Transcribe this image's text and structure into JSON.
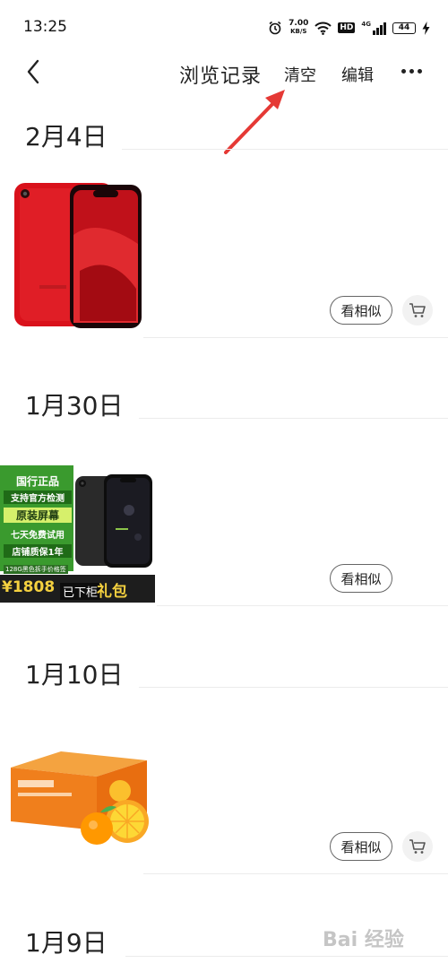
{
  "status_bar": {
    "time": "13:25",
    "net_speed_value": "7.00",
    "net_speed_unit": "KB/S",
    "hd_badge": "HD",
    "signal_label": "4G",
    "battery_level": "44"
  },
  "header": {
    "title": "浏览记录",
    "clear_label": "清空",
    "edit_label": "编辑"
  },
  "groups": [
    {
      "date": "2月4日",
      "item": {
        "similar_label": "看相似",
        "has_cart": true
      }
    },
    {
      "date": "1月30日",
      "item": {
        "similar_label": "看相似",
        "has_cart": false,
        "poster": {
          "line1": "国行正品",
          "line2": "支持官方检测",
          "line3": "原装屏幕",
          "line4": "七天免费试用",
          "line5": "店铺质保1年",
          "spec": "128G黑色拆手价格签",
          "price": "¥1808",
          "status": "已下柜",
          "gift": "礼包"
        }
      }
    },
    {
      "date": "1月10日",
      "item": {
        "similar_label": "看相似",
        "has_cart": true
      }
    },
    {
      "date": "1月9日"
    }
  ],
  "watermark": "Bai 经验",
  "colors": {
    "accent_red": "#e53935",
    "divider": "#ececec",
    "text": "#222222",
    "poster_green": "#3a9a2e"
  }
}
